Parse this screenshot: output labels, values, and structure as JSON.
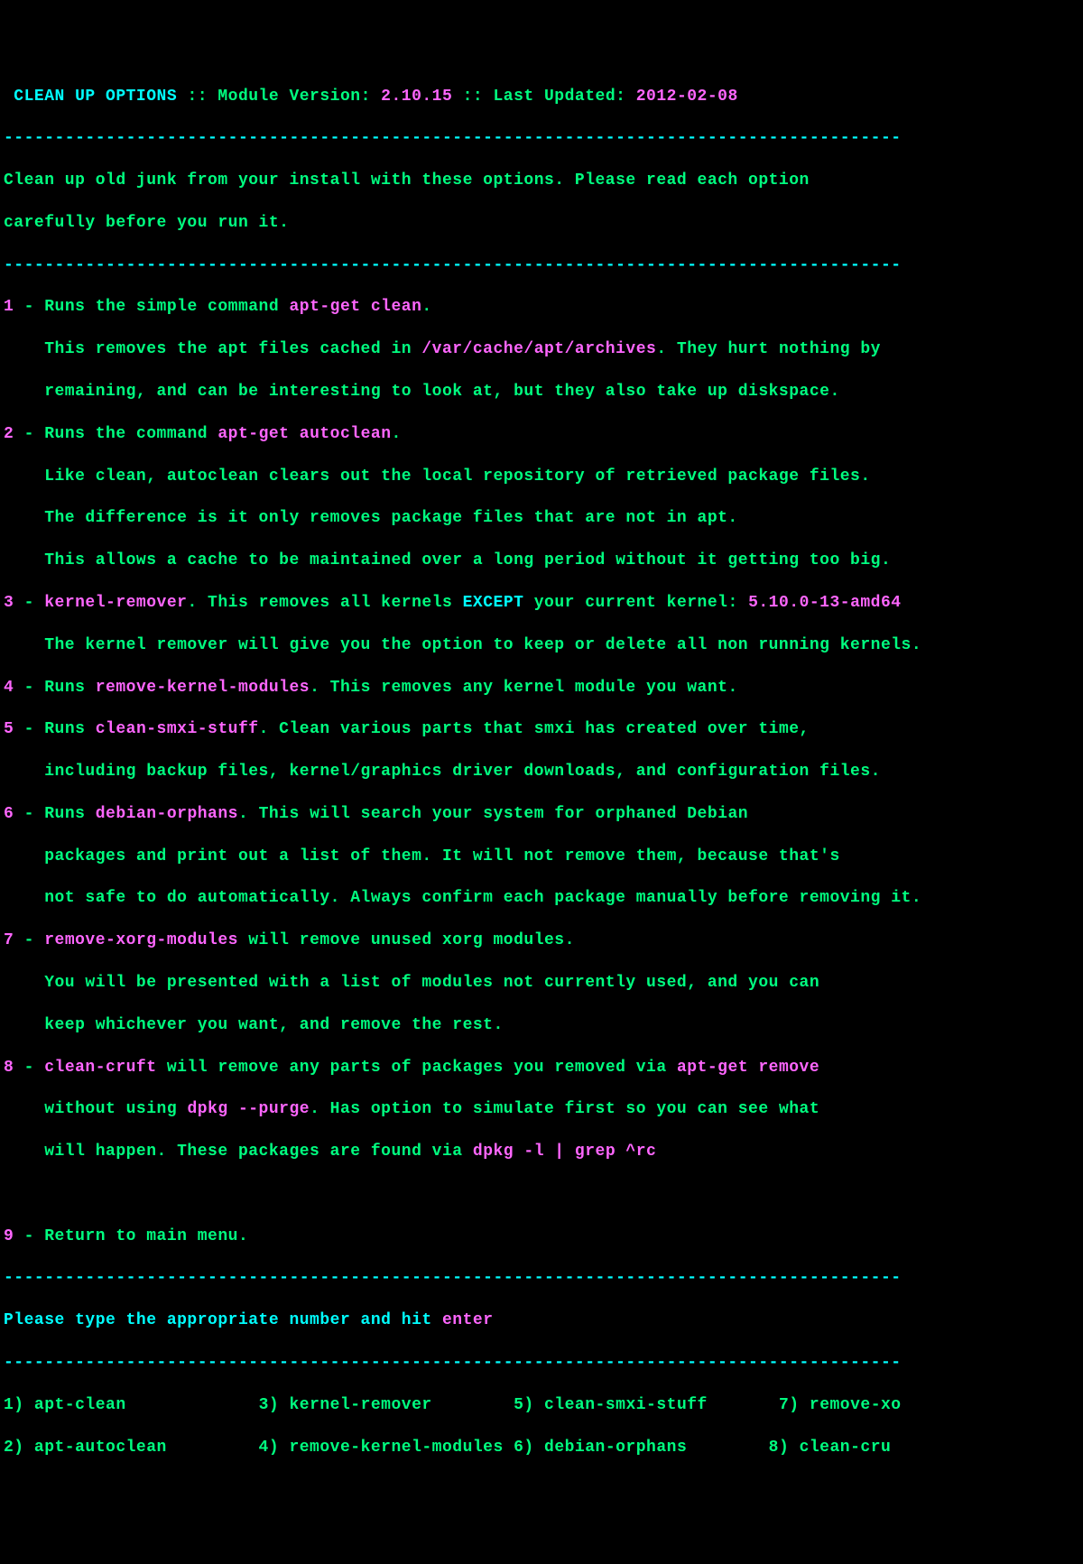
{
  "header": {
    "title": " CLEAN UP OPTIONS ",
    "sep1": ":: ",
    "mod_label": "Module Version: ",
    "module_version": "2.10.15 ",
    "sep2": ":: ",
    "upd_label": "Last Updated: ",
    "last_updated": "2012-02-08"
  },
  "dashes": "----------------------------------------------------------------------------------------",
  "intro": {
    "l1": "Clean up old junk from your install with these options. Please read each option",
    "l2": "carefully before you run it."
  },
  "o1": {
    "num": "1",
    "dash": " - ",
    "a": "Runs the simple command ",
    "cmd": "apt-get clean",
    "b": ".",
    "l2a": "    This removes the apt files cached in ",
    "path": "/var/cache/apt/archives",
    "l2b": ". They hurt nothing by",
    "l3": "    remaining, and can be interesting to look at, but they also take up diskspace."
  },
  "o2": {
    "num": "2",
    "dash": " - ",
    "a": "Runs the command ",
    "cmd": "apt-get autoclean",
    "b": ".",
    "l2": "    Like clean, autoclean clears out the local repository of retrieved package files.",
    "l3": "    The difference is it only removes package files that are not in apt.",
    "l4": "    This allows a cache to be maintained over a long period without it getting too big."
  },
  "o3": {
    "num": "3",
    "dash": " - ",
    "cmd": "kernel-remover",
    "a": ". This removes all kernels ",
    "exc": "EXCEPT",
    "b": " your current kernel: ",
    "kver": "5.10.0-13-amd64",
    "l2": "    The kernel remover will give you the option to keep or delete all non running kernels."
  },
  "o4": {
    "num": "4",
    "dash": " - ",
    "a": "Runs ",
    "cmd": "remove-kernel-modules",
    "b": ". This removes any kernel module you want."
  },
  "o5": {
    "num": "5",
    "dash": " - ",
    "a": "Runs ",
    "cmd": "clean-smxi-stuff",
    "b": ". Clean various parts that smxi has created over time,",
    "l2": "    including backup files, kernel/graphics driver downloads, and configuration files."
  },
  "o6": {
    "num": "6",
    "dash": " - ",
    "a": "Runs ",
    "cmd": "debian-orphans",
    "b": ". This will search your system for orphaned Debian",
    "l2": "    packages and print out a list of them. It will not remove them, because that's",
    "l3": "    not safe to do automatically. Always confirm each package manually before removing it."
  },
  "o7": {
    "num": "7",
    "dash": " - ",
    "cmd": "remove-xorg-modules",
    "a": " will remove unused xorg modules.",
    "l2": "    You will be presented with a list of modules not currently used, and you can",
    "l3": "    keep whichever you want, and remove the rest."
  },
  "o8": {
    "num": "8",
    "dash": " - ",
    "cmd": "clean-cruft",
    "a": " will remove any parts of packages you removed via ",
    "cmd2": "apt-get remove",
    "l2a": "    without using ",
    "cmd3": "dpkg --purge",
    "l2b": ". Has option to simulate first so you can see what",
    "l3a": "    will happen. These packages are found via ",
    "cmd4": "dpkg -l | grep ^rc"
  },
  "o9": {
    "num": "9",
    "dash": " - ",
    "a": "Return to main menu."
  },
  "prompt": {
    "a": "Please type the appropriate number and hit ",
    "b": "enter"
  },
  "menu": {
    "c1a": "1) apt-clean",
    "c1b": "2) apt-autoclean",
    "c2a": "3) kernel-remover",
    "c2b": "4) remove-kernel-modules",
    "c3a": "5) clean-smxi-stuff",
    "c3b": "6) debian-orphans",
    "c4a": "7) remove-xo",
    "c4b": "8) clean-cru"
  },
  "spacing": {
    "m_gap1a": "             ",
    "m_gap2a": "        ",
    "m_gap3a": "       ",
    "m_gap1b": "         ",
    "m_gap2b": " ",
    "m_gap3b": "        "
  }
}
